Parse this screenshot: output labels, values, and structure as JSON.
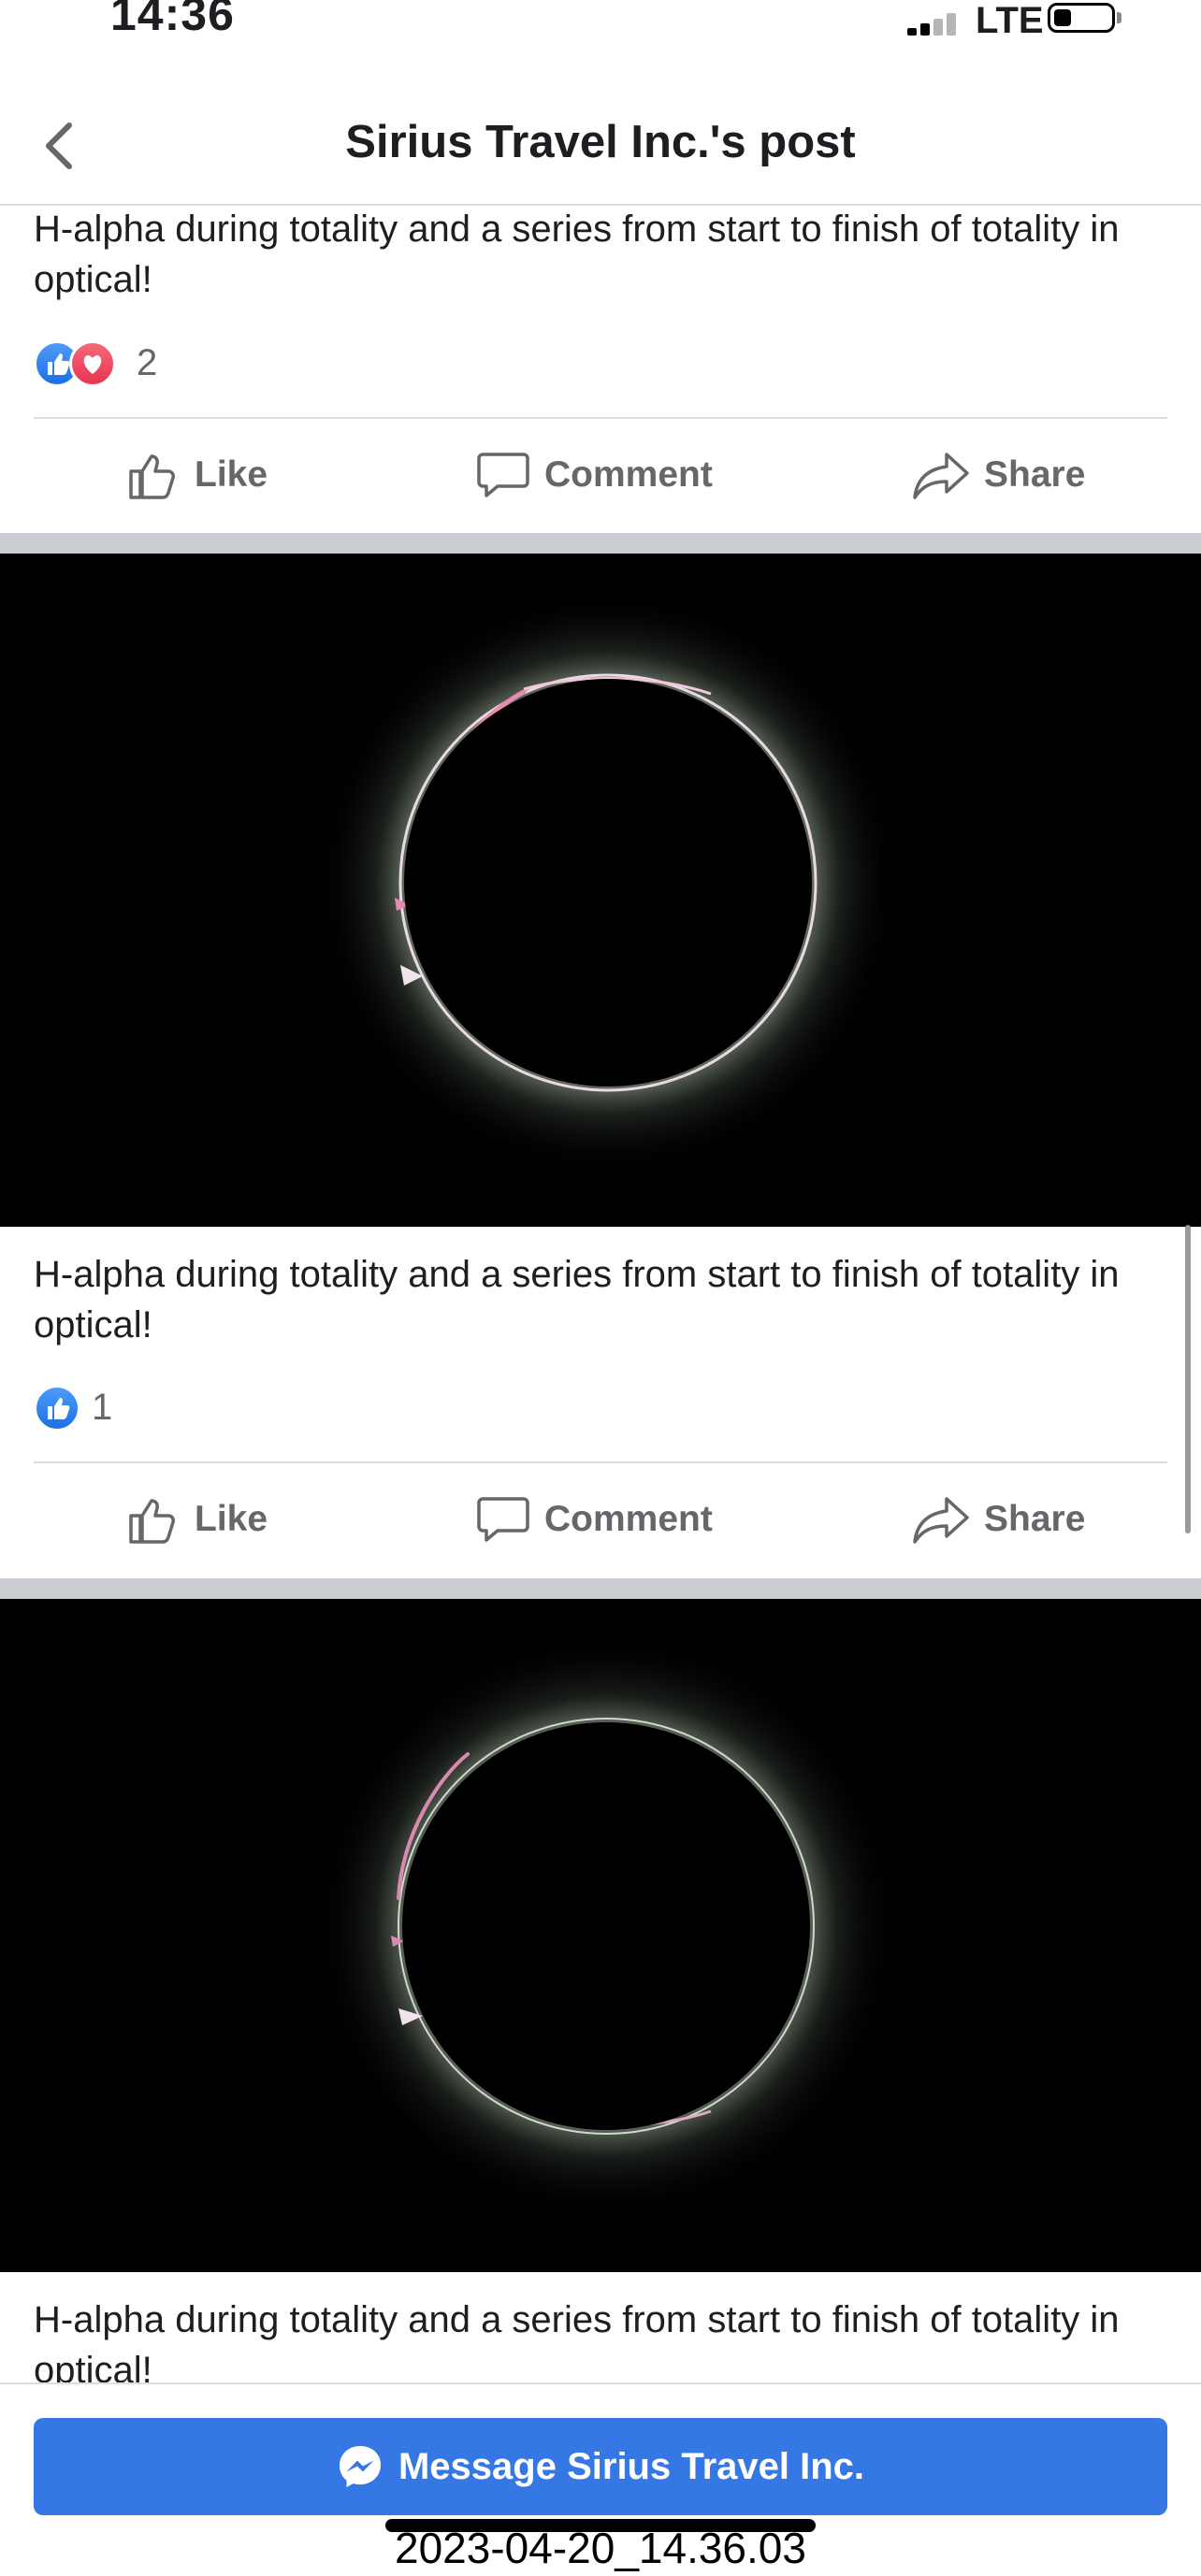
{
  "status_bar": {
    "time": "14:36",
    "network": "LTE"
  },
  "nav": {
    "title": "Sirius Travel Inc.'s post"
  },
  "posts": [
    {
      "caption": "H-alpha during totality and a series from start to finish of totality in optical!",
      "reactions": [
        "like",
        "love"
      ],
      "reaction_count": "2"
    },
    {
      "caption": "H-alpha during totality and a series from start to finish of totality in optical!",
      "reactions": [
        "like"
      ],
      "reaction_count": "1"
    },
    {
      "caption": "H-alpha during totality and a series from start to finish of totality in optical!"
    }
  ],
  "actions": {
    "like": "Like",
    "comment": "Comment",
    "share": "Share"
  },
  "message_button": {
    "label": "Message Sirius Travel Inc."
  },
  "screenshot_timestamp": "2023-04-20_14.36.03",
  "icons": [
    "chevron-left-icon",
    "thumbs-up-icon",
    "heart-icon",
    "comment-icon",
    "share-icon",
    "messenger-icon"
  ],
  "colors": {
    "accent": "#3578e5",
    "like": "#1b70e6",
    "love": "#e8334f",
    "separator": "#c9ccd1"
  }
}
